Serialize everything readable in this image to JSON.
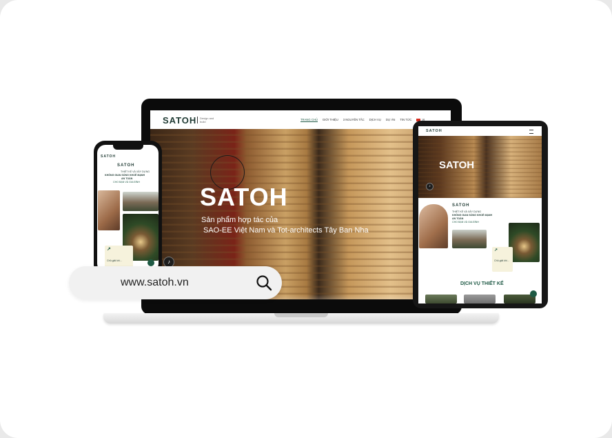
{
  "laptop": {
    "logo": "SATOH",
    "logo_tagline": "Design and build",
    "nav": [
      "TRANG CHỦ",
      "GIỚI THIỆU",
      "3 NGUYÊN TẮC",
      "DỊCH VỤ",
      "DỰ ÁN",
      "TIN TỨC",
      "VI"
    ],
    "hero_title": "SATOH",
    "hero_subtitle_line1": "Sản phẩm hợp tác của",
    "hero_subtitle_line2": "SAO-EE Việt Nam và Tot-architects Tây Ban Nha"
  },
  "phone": {
    "logo": "SATOH",
    "headline_1": "THIẾT KẾ VÀ XÂY DỰNG",
    "headline_2": "KHÔNG GIAN SỐNG KHOẺ MẠNH",
    "headline_3": "AN TOÀN",
    "headline_4": "CHO BẠN VÀ GIA ĐÌNH",
    "card_label": "Chủ giải khi..."
  },
  "tablet": {
    "logo": "SATOH",
    "hero_title": "SATOH",
    "section_title": "DỊCH VỤ THIẾT KẾ",
    "card_label": "Chủ giải khi..."
  },
  "search": {
    "url": "www.satoh.vn"
  },
  "colors": {
    "brand_green": "#1f5a46",
    "dark": "#111111"
  }
}
